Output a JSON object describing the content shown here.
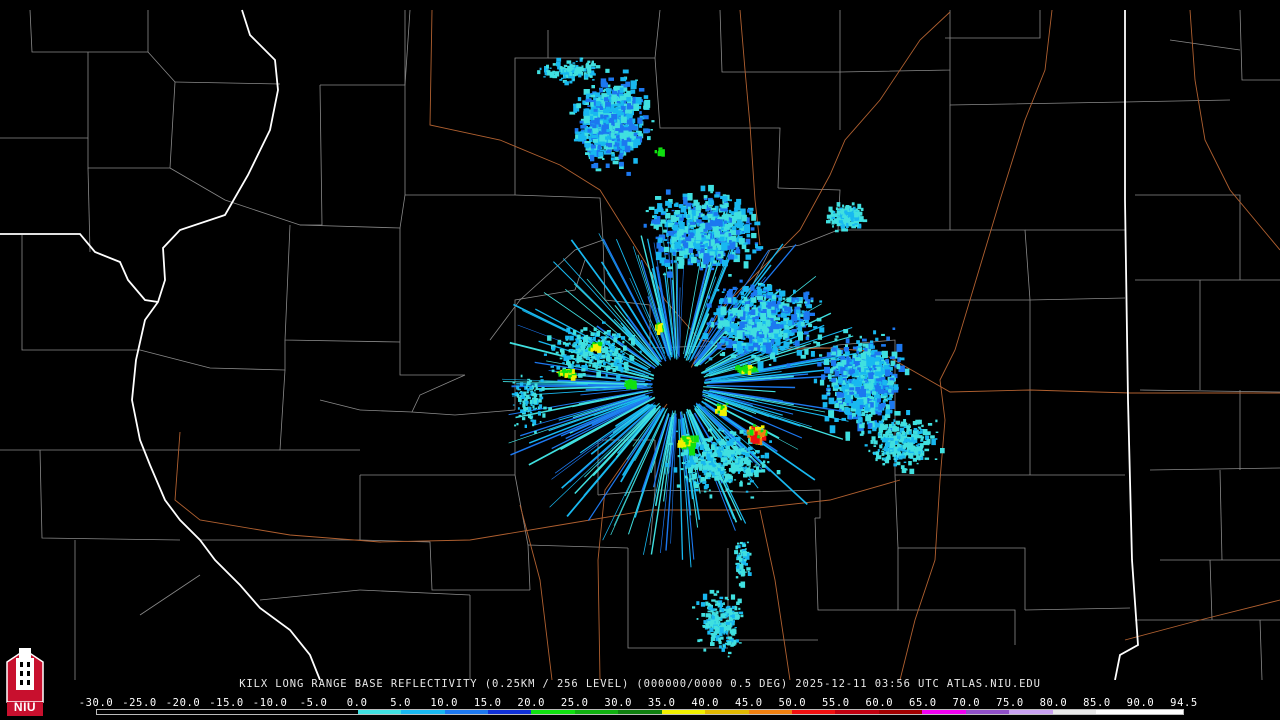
{
  "product": {
    "caption": "KILX LONG RANGE BASE REFLECTIVITY (0.25KM / 256 LEVEL) (000000/0000 0.5 DEG) 2025-12-11 03:56 UTC  ATLAS.NIU.EDU"
  },
  "logo": {
    "text": "NIU",
    "icon": "niu-tower-logo-icon",
    "color": "#c8102e"
  },
  "legend": {
    "unit_values": [
      "-30.0",
      "-25.0",
      "-20.0",
      "-15.0",
      "-10.0",
      "-5.0",
      "0.0",
      "5.0",
      "10.0",
      "15.0",
      "20.0",
      "25.0",
      "30.0",
      "35.0",
      "40.0",
      "45.0",
      "50.0",
      "55.0",
      "60.0",
      "65.0",
      "70.0",
      "75.0",
      "80.0",
      "85.0",
      "90.0",
      "94.5"
    ],
    "colors": [
      "#000000",
      "#000000",
      "#000000",
      "#000000",
      "#000000",
      "#000000",
      "#40e0e0",
      "#18b8f0",
      "#1c78f0",
      "#1030d8",
      "#10e010",
      "#10b010",
      "#108010",
      "#f0f000",
      "#e0b800",
      "#f08010",
      "#f01010",
      "#c00010",
      "#a00000",
      "#f000f0",
      "#9050c8",
      "#c8a0f0",
      "#e8e8e8",
      "#ffffff",
      "#ffffff"
    ]
  },
  "map": {
    "radar_site": "KILX",
    "reflectivity_colors": {
      "light": "#40e0e0",
      "light_blue": "#18b8f0",
      "blue": "#1c78f0",
      "green": "#10e010",
      "yellow": "#f0f000",
      "orange": "#f08010",
      "red": "#f01010"
    },
    "colors": {
      "county": "#8a8a8a",
      "state": "#ffffff",
      "highway": "#b06030",
      "background": "#000000"
    }
  }
}
